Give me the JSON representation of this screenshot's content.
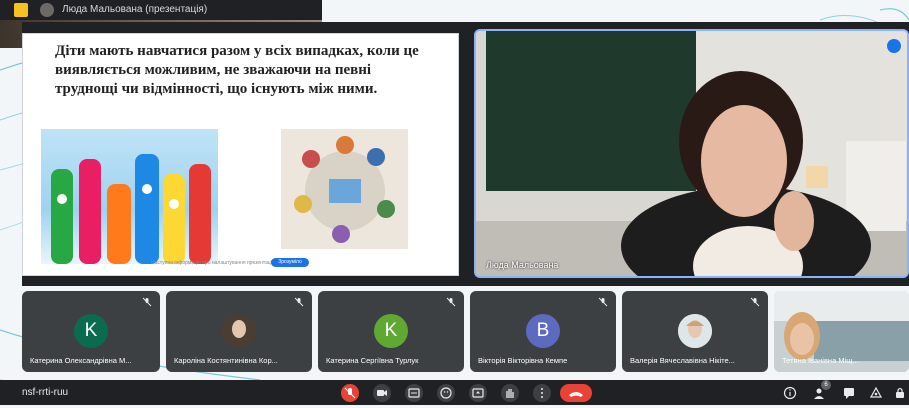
{
  "top_strip": {
    "presenter_label": "Люда Мальована (презентація)"
  },
  "slide": {
    "text": "Діти мають навчатися разом у всіх випадках, коли це виявляється можливим, не зважаючи на певні труднощі чи відмінності, що існують між ними.",
    "notice_text": "Наступна інформація про налаштування презентації",
    "notice_button": "Зрозуміло"
  },
  "presenter": {
    "name": "Люда Мальована"
  },
  "participants": [
    {
      "name": "Катерина Олександрівна М...",
      "initial": "K",
      "color": "#0b6b4f",
      "type": "letter"
    },
    {
      "name": "Кароліна Костянтинівна Кор...",
      "initial": "",
      "color": "#3c4043",
      "type": "photo"
    },
    {
      "name": "Катерина Сергіївна Турлук",
      "initial": "K",
      "color": "#5fa832",
      "type": "letter"
    },
    {
      "name": "Вікторія Вікторівна Кемпе",
      "initial": "B",
      "color": "#5c6bc0",
      "type": "letter"
    },
    {
      "name": "Валерія Вячеславівна Нікіте...",
      "initial": "",
      "color": "#3c4043",
      "type": "photo"
    },
    {
      "name": "Тетяна Іванівна Міщ...",
      "initial": "",
      "color": "#3c4043",
      "type": "camera"
    }
  ],
  "controls": {
    "meeting_code": "nsf-rrti-ruu",
    "people_count": "6",
    "icons": [
      "mic-off-icon",
      "camera-icon",
      "captions-icon",
      "emoji-icon",
      "present-icon",
      "raise-hand-icon",
      "more-icon",
      "end-call-icon"
    ],
    "right_icons": [
      "info-icon",
      "people-icon",
      "chat-icon",
      "activities-icon",
      "lock-icon"
    ]
  },
  "colors": {
    "accent": "#1a73e8",
    "danger": "#ea4335",
    "tile_bg": "#3c4043",
    "bar_bg": "#202124"
  }
}
